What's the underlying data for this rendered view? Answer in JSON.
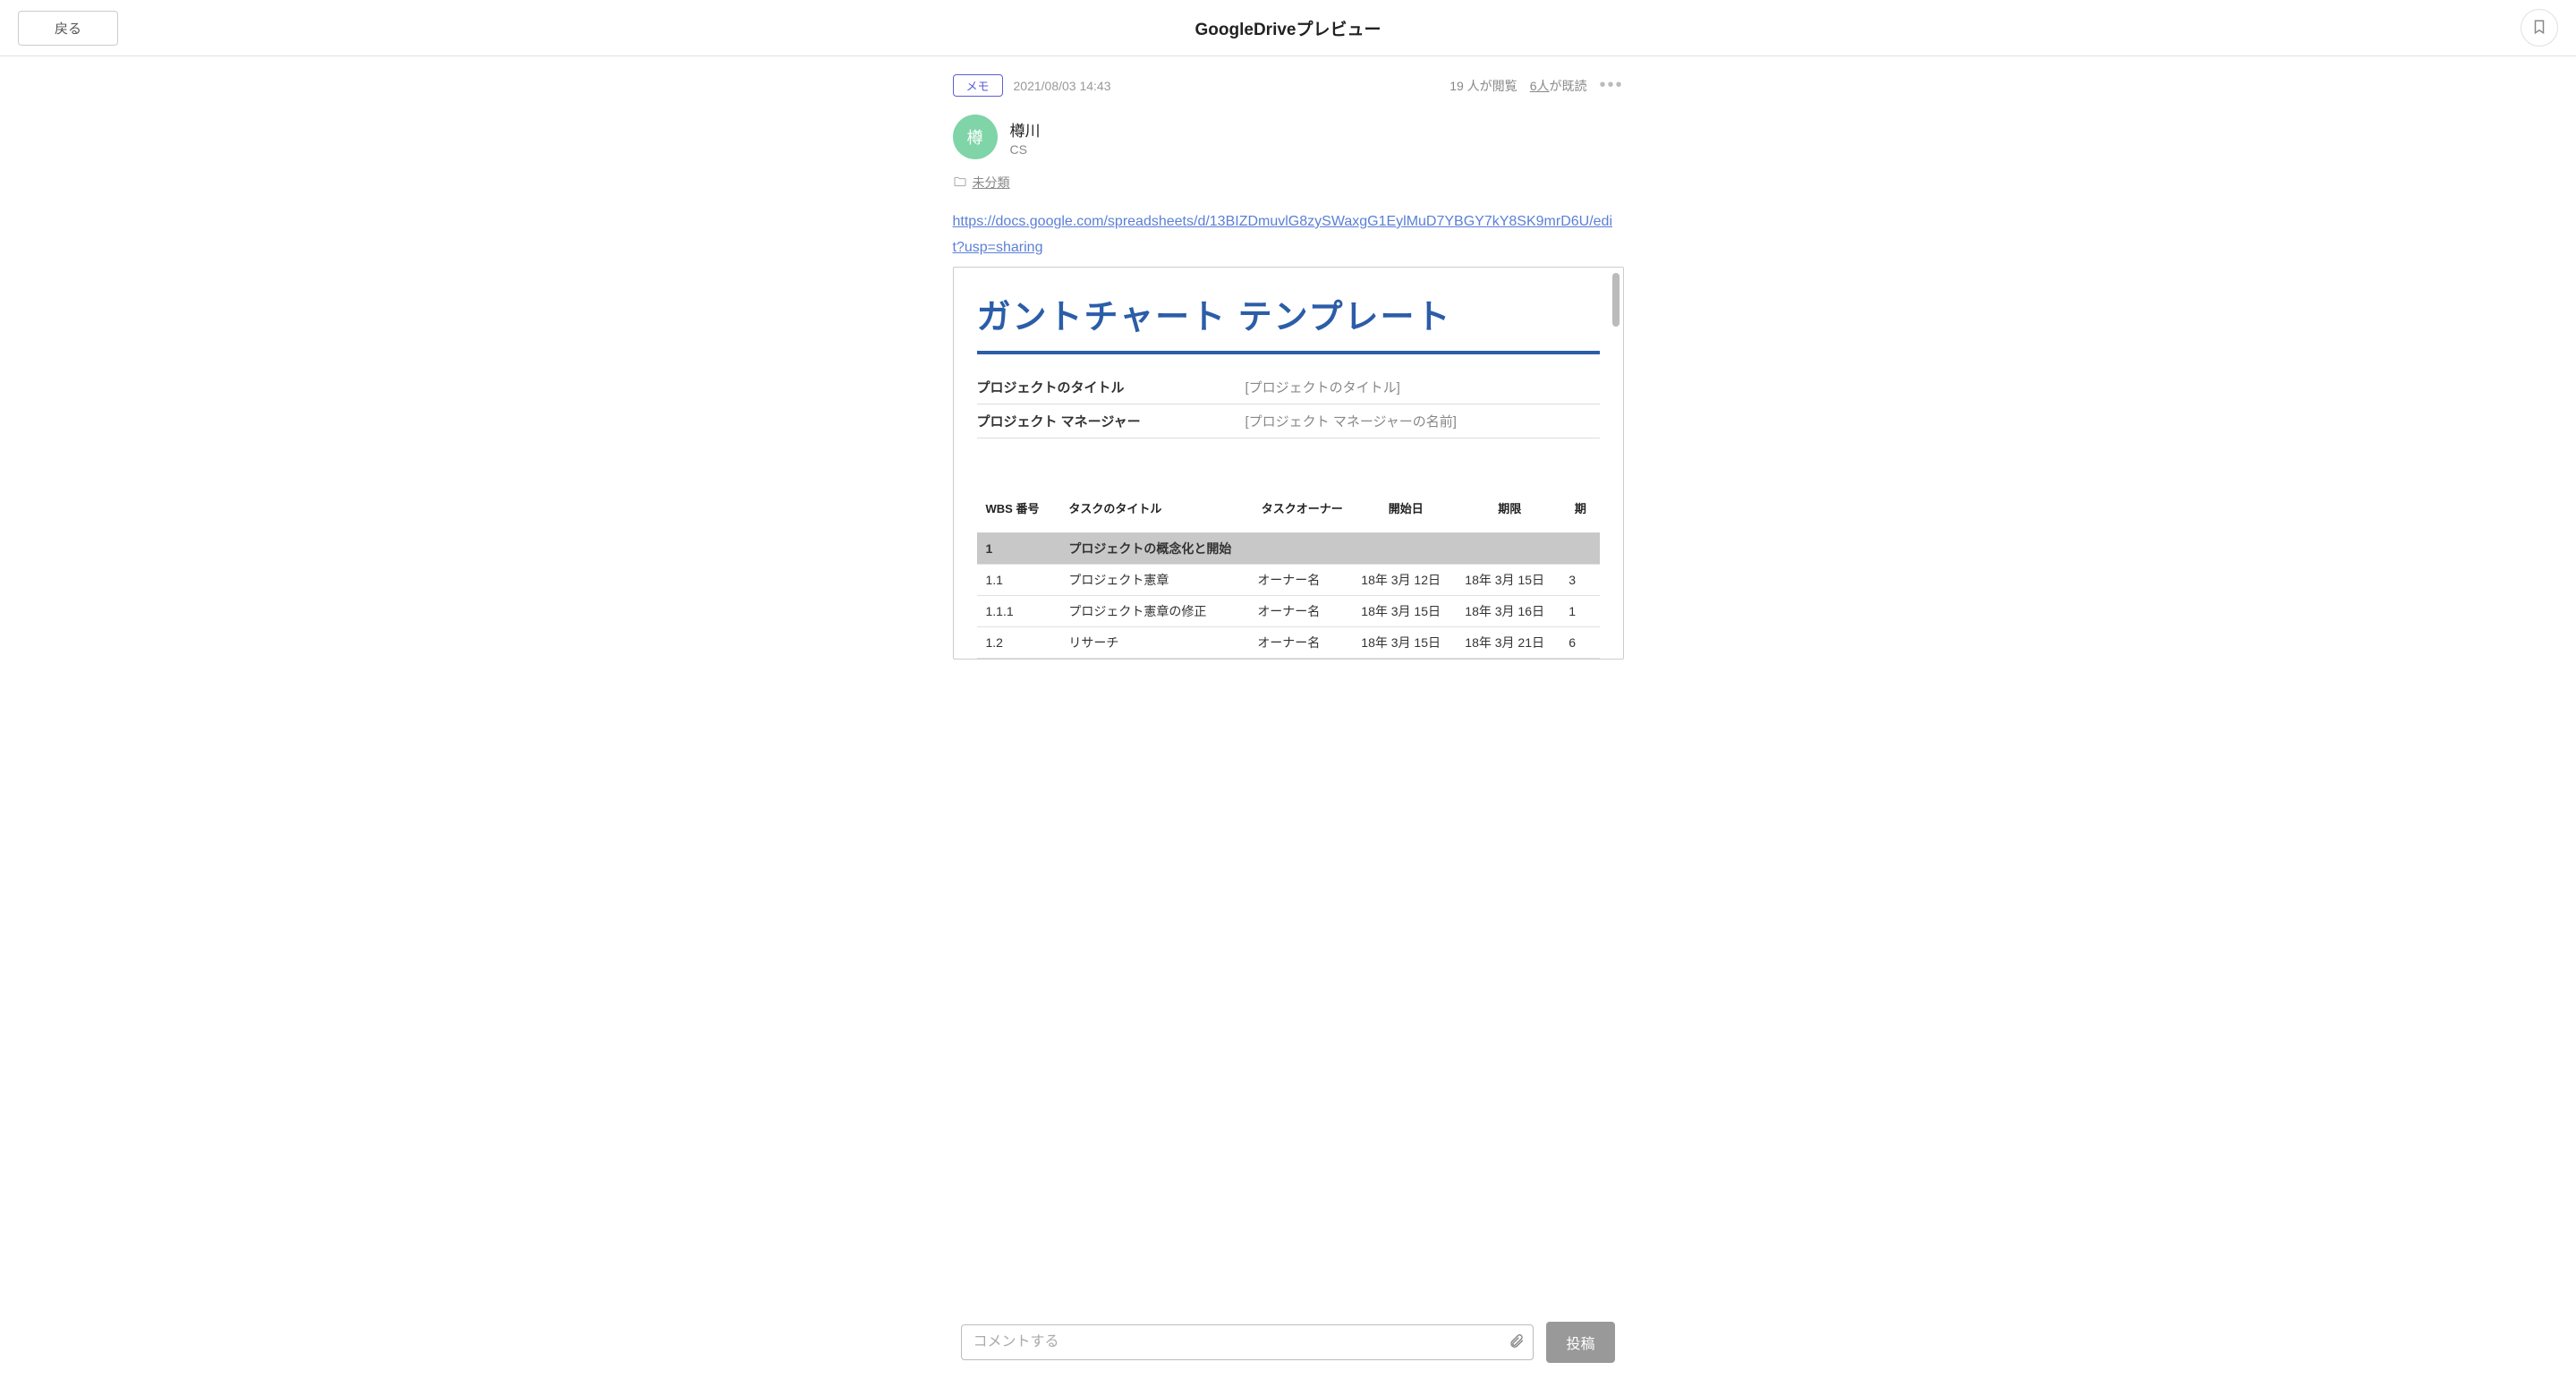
{
  "header": {
    "back_label": "戻る",
    "title": "GoogleDriveプレビュー"
  },
  "meta": {
    "memo_badge": "メモ",
    "timestamp": "2021/08/03 14:43",
    "view_count": "19 人が閲覧",
    "read_link": "6人",
    "read_suffix": "が既読"
  },
  "author": {
    "avatar_char": "樽",
    "name": "樽川",
    "dept": "CS"
  },
  "category": {
    "label": "未分類"
  },
  "doc_link": "https://docs.google.com/spreadsheets/d/13BIZDmuvlG8zySWaxgG1EylMuD7YBGY7kY8SK9mrD6U/edit?usp=sharing",
  "sheet": {
    "title": "ガントチャート テンプレート",
    "fields": [
      {
        "label": "プロジェクトのタイトル",
        "value": "[プロジェクトのタイトル]"
      },
      {
        "label": "プロジェクト マネージャー",
        "value": "[プロジェクト マネージャーの名前]"
      }
    ],
    "columns": [
      "WBS 番号",
      "タスクのタイトル",
      "タスクオーナー",
      "開始日",
      "期限",
      "期"
    ],
    "rows": [
      {
        "section": true,
        "wbs": "1",
        "title": "プロジェクトの概念化と開始"
      },
      {
        "wbs": "1.1",
        "title": "プロジェクト憲章",
        "owner": "オーナー名",
        "start": "18年 3月 12日",
        "end": "18年 3月 15日",
        "last": "3"
      },
      {
        "wbs": "1.1.1",
        "title": "プロジェクト憲章の修正",
        "owner": "オーナー名",
        "start": "18年 3月 15日",
        "end": "18年 3月 16日",
        "last": "1"
      },
      {
        "wbs": "1.2",
        "title": "リサーチ",
        "owner": "オーナー名",
        "start": "18年 3月 15日",
        "end": "18年 3月 21日",
        "last": "6"
      }
    ]
  },
  "comment": {
    "placeholder": "コメントする",
    "post_label": "投稿"
  }
}
